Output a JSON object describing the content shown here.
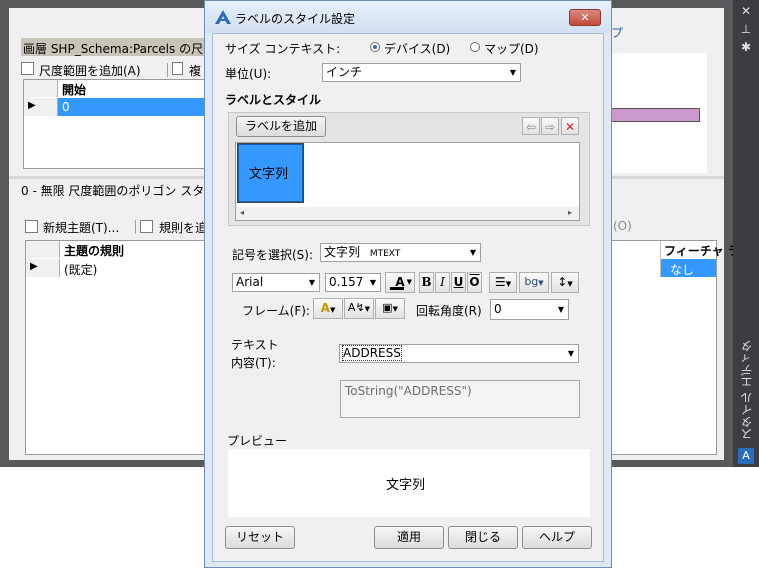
{
  "bg": {
    "layer_label": "画層 SHP_Schema:Parcels の尺",
    "add_scale_range": "尺度範囲を追加(A)",
    "copy_label": "複",
    "col_start": "開始",
    "row_start_value": "0",
    "mid_label": "0 - 無限 尺度範囲のポリゴン スタ",
    "new_theme": "新規主題(T)...",
    "add_rule": "規則を追",
    "col_theme_rule": "主題の規則",
    "row_rule_value": "(既定)",
    "col_feature": "フィーチャ ラ",
    "row_feature_value": "なし",
    "zero_paren": "(O)",
    "help_fragment": "プ"
  },
  "sidebar": {
    "title": "スタイル エディタ",
    "icons": [
      "close-icon",
      "pin-icon",
      "settings-icon",
      "autocad-logo"
    ]
  },
  "dialog": {
    "title": "ラベルのスタイル設定",
    "size_context_label": "サイズ コンテキスト:",
    "radio_device": "デバイス(D)",
    "radio_map": "マップ(D)",
    "unit_label": "単位(U):",
    "unit_value": "インチ",
    "section_label": "ラベルとスタイル",
    "add_label_btn": "ラベルを追加",
    "label_item": "文字列",
    "symbol_label": "記号を選択(S):",
    "symbol_value": "文字列",
    "symbol_type": "MTEXT",
    "font_value": "Arial",
    "size_value": "0.157",
    "bold": "B",
    "italic": "I",
    "underline": "U",
    "overline": "O",
    "bg_label": "bg",
    "frame_label": "フレーム(F):",
    "rotation_label": "回転角度(R)",
    "rotation_value": "0",
    "text_content_label1": "テキスト",
    "text_content_label2": "内容(T):",
    "text_content_value": "ADDRESS",
    "expression_value": "ToString(\"ADDRESS\")",
    "preview_label": "プレビュー",
    "preview_text": "文字列",
    "reset_btn": "リセット",
    "apply_btn": "適用",
    "close_btn": "閉じる",
    "help_btn": "ヘルプ"
  },
  "colors": {
    "accent": "#3399ff",
    "bg_window_frame": "#58595b",
    "side_bar": "#3b3d40",
    "close_button": "#c75050",
    "purple_bar": "#cc99cc"
  }
}
